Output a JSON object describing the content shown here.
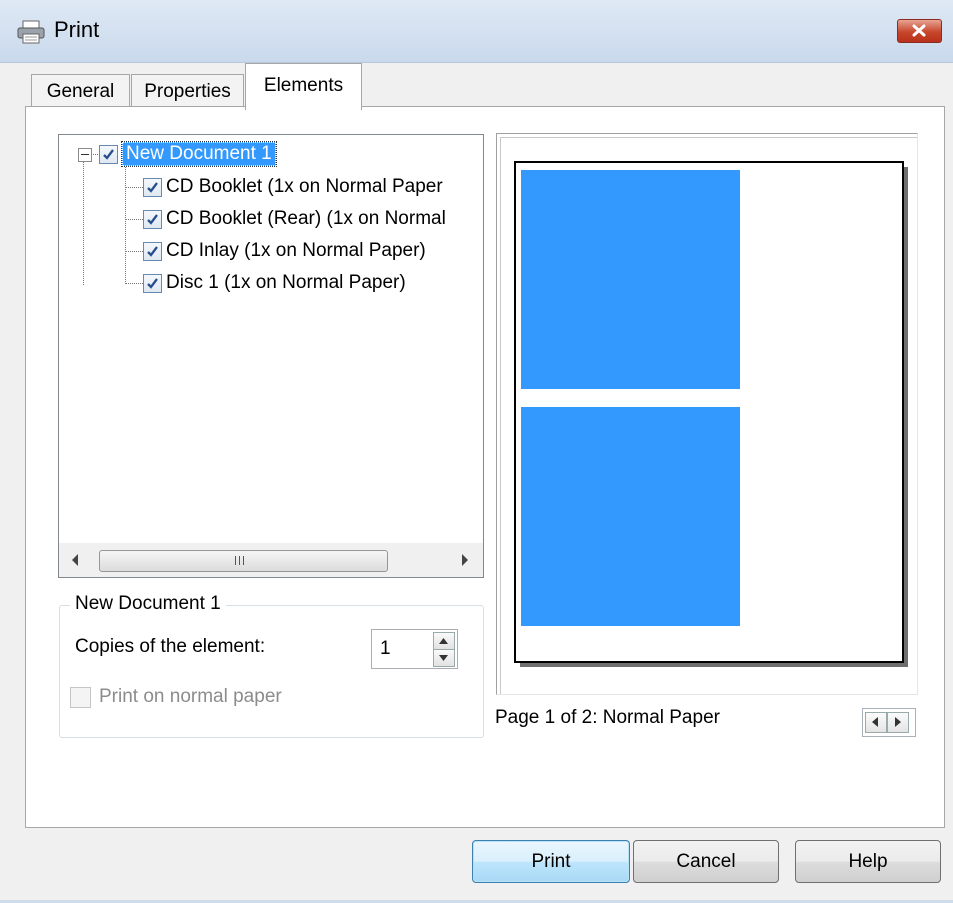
{
  "window": {
    "title": "Print",
    "icon": "printer-icon",
    "close_icon": "close-icon"
  },
  "tabs": [
    {
      "label": "General",
      "selected": false
    },
    {
      "label": "Properties",
      "selected": false
    },
    {
      "label": "Elements",
      "selected": true
    }
  ],
  "tree": {
    "root": {
      "label": "New Document 1",
      "checked": true,
      "expanded": true,
      "selected": true
    },
    "children": [
      {
        "label": "CD Booklet (1x on Normal Paper",
        "checked": true
      },
      {
        "label": "CD Booklet (Rear) (1x on Normal",
        "checked": true
      },
      {
        "label": "CD Inlay (1x on Normal Paper)",
        "checked": true
      },
      {
        "label": "Disc 1 (1x on Normal Paper)",
        "checked": true
      }
    ]
  },
  "element_group": {
    "title": "New Document 1",
    "copies_label": "Copies of the element:",
    "copies_value": "1",
    "print_on_normal_paper_label": "Print on normal paper",
    "print_on_normal_paper_checked": false,
    "print_on_normal_paper_enabled": false
  },
  "preview": {
    "status": "Page 1 of 2: Normal Paper",
    "element_color": "#3399ff"
  },
  "buttons": {
    "print": "Print",
    "cancel": "Cancel",
    "help": "Help"
  },
  "colors": {
    "selection": "#3399ff",
    "close_button": "#c7462c"
  }
}
